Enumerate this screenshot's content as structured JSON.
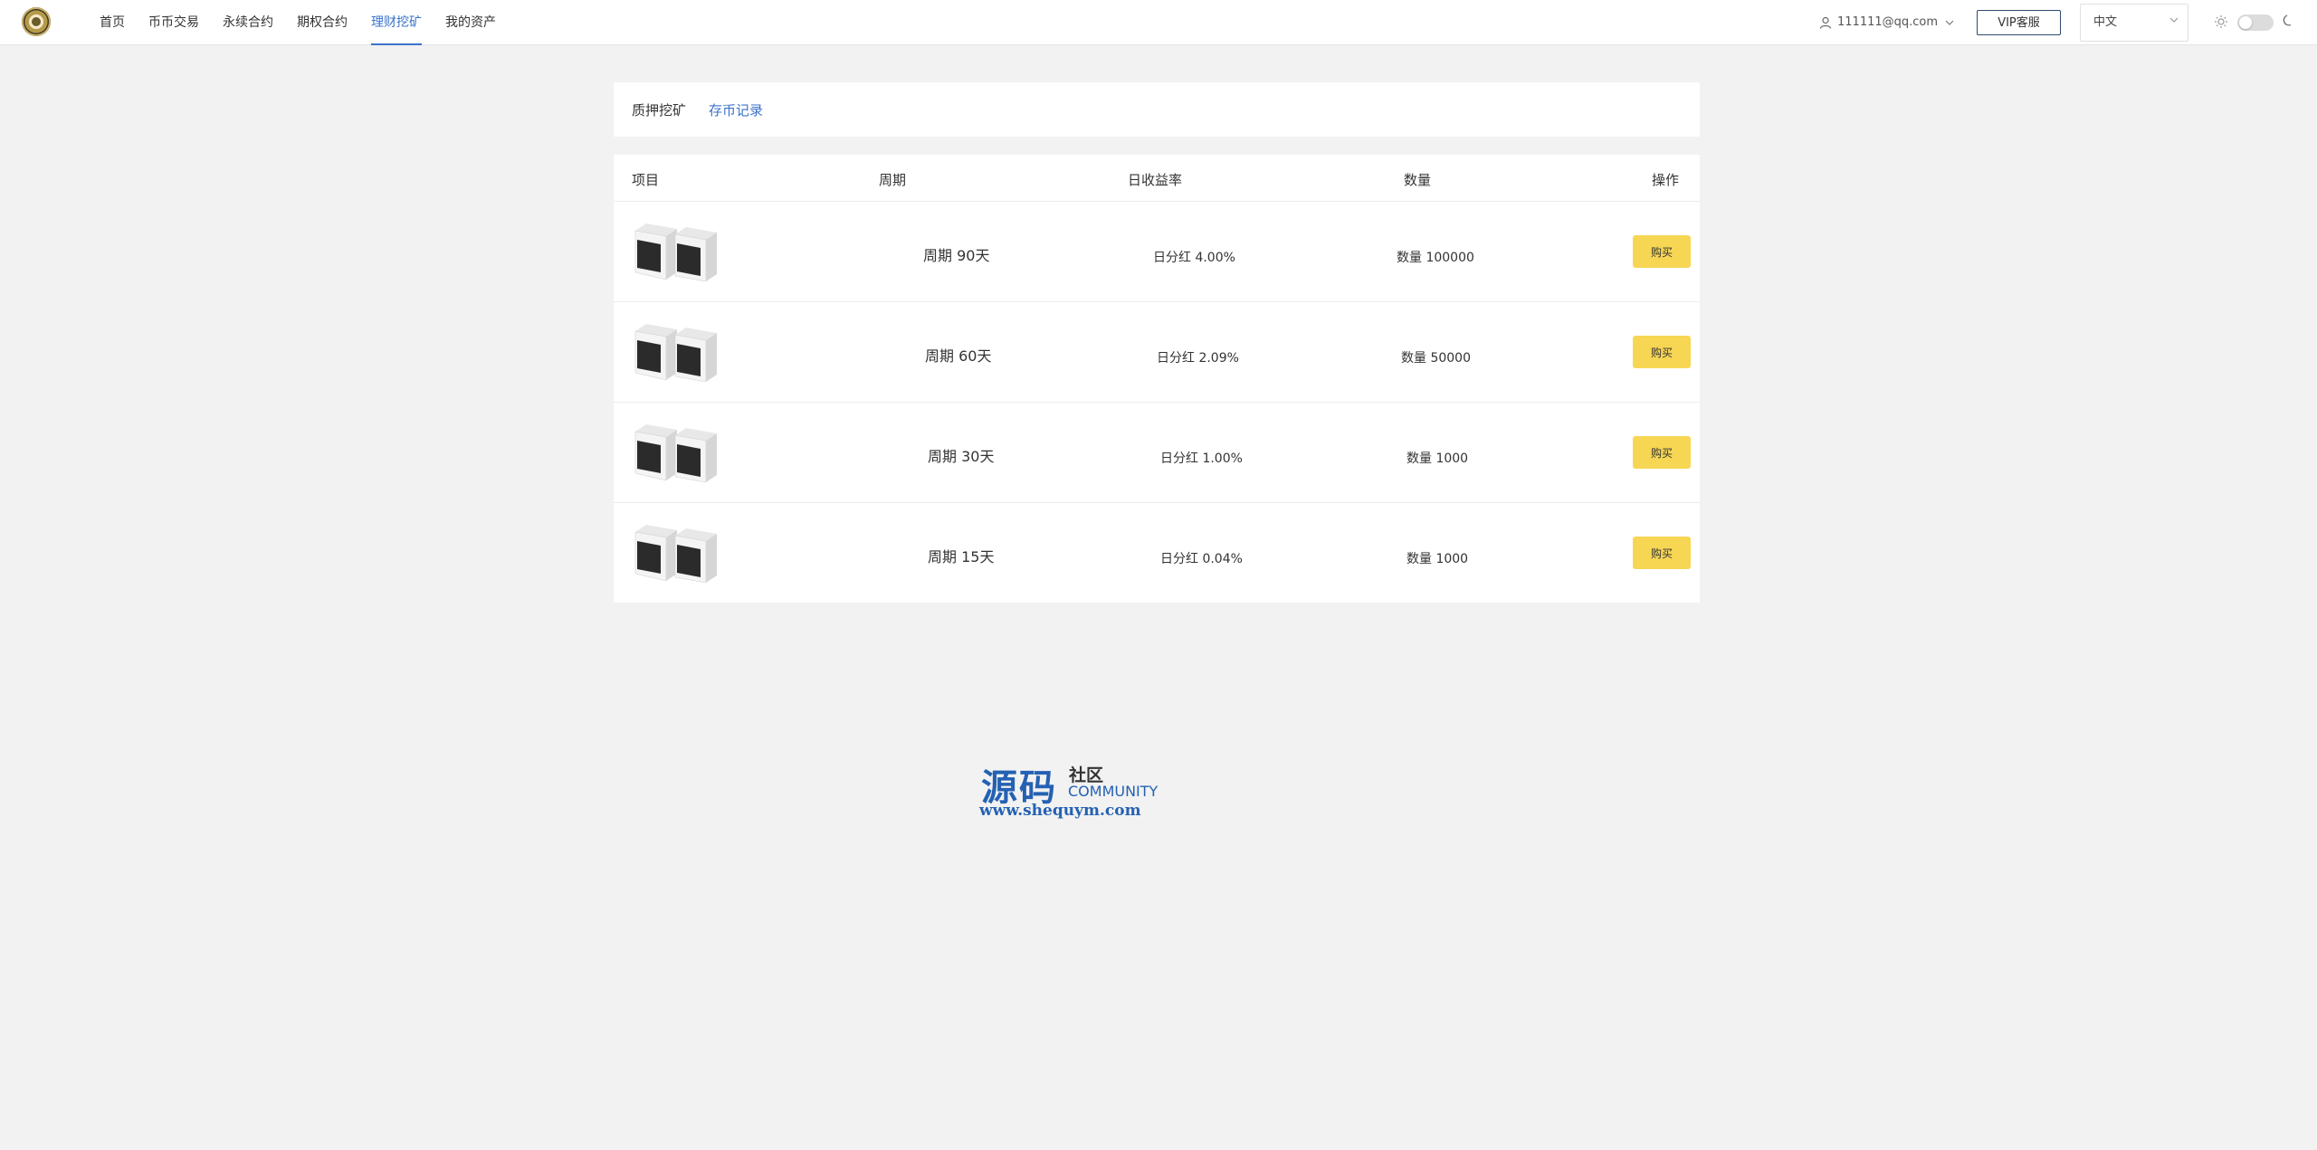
{
  "header": {
    "nav": [
      {
        "label": "首页"
      },
      {
        "label": "币币交易"
      },
      {
        "label": "永续合约"
      },
      {
        "label": "期权合约"
      },
      {
        "label": "理财挖矿",
        "active": true
      },
      {
        "label": "我的资产"
      }
    ],
    "user_email": "111111@qq.com",
    "vip_label": "VIP客服",
    "language": "中文",
    "accent_color": "#3b73c9"
  },
  "tabs": [
    {
      "label": "质押挖矿"
    },
    {
      "label": "存币记录"
    }
  ],
  "table": {
    "headers": {
      "item": "项目",
      "period": "周期",
      "rate": "日收益率",
      "quantity": "数量",
      "action": "操作"
    },
    "rows": [
      {
        "period": "周期 90天",
        "rate": "日分红 4.00%",
        "quantity": "数量 100000",
        "button": "购买"
      },
      {
        "period": "周期 60天",
        "rate": "日分红 2.09%",
        "quantity": "数量 50000",
        "button": "购买"
      },
      {
        "period": "周期 30天",
        "rate": "日分红 1.00%",
        "quantity": "数量 1000",
        "button": "购买"
      },
      {
        "period": "周期 15天",
        "rate": "日分红 0.04%",
        "quantity": "数量 1000",
        "button": "购买"
      }
    ],
    "button_color": "#f7d654"
  },
  "watermark": {
    "title": "源码",
    "subtitle": "社区",
    "community": "COMMUNITY",
    "url": "www.shequym.com"
  }
}
